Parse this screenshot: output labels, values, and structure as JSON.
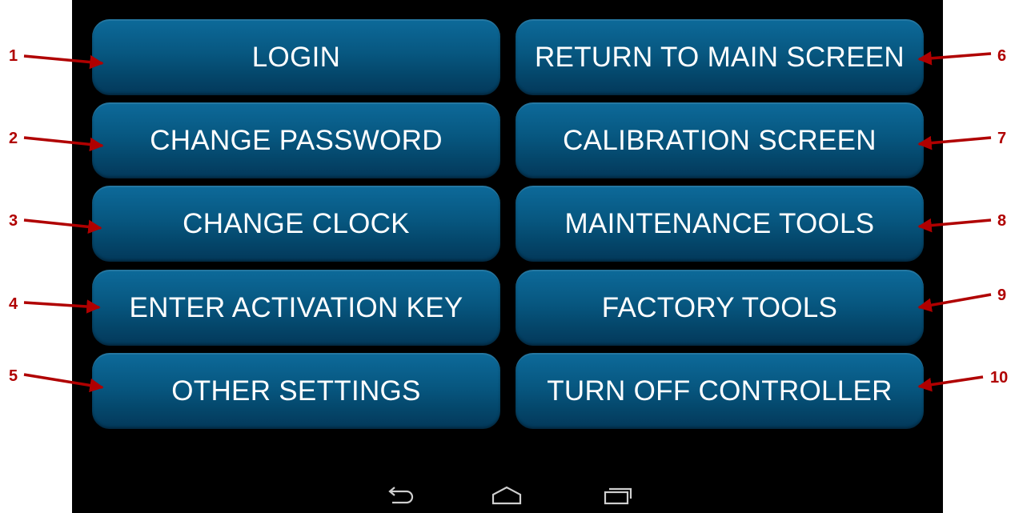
{
  "buttons_left": [
    {
      "label": "LOGIN",
      "callout": "1"
    },
    {
      "label": "CHANGE PASSWORD",
      "callout": "2"
    },
    {
      "label": "CHANGE CLOCK",
      "callout": "3"
    },
    {
      "label": "ENTER ACTIVATION KEY",
      "callout": "4"
    },
    {
      "label": "OTHER SETTINGS",
      "callout": "5"
    }
  ],
  "buttons_right": [
    {
      "label": "RETURN TO MAIN SCREEN",
      "callout": "6"
    },
    {
      "label": "CALIBRATION SCREEN",
      "callout": "7"
    },
    {
      "label": "MAINTENANCE TOOLS",
      "callout": "8"
    },
    {
      "label": "FACTORY TOOLS",
      "callout": "9"
    },
    {
      "label": "TURN OFF CONTROLLER",
      "callout": "10"
    }
  ],
  "navbar": {
    "icons": [
      "back-icon",
      "home-icon",
      "recent-apps-icon"
    ]
  },
  "colors": {
    "callout": "#b00000",
    "button_top": "#0d6a9a",
    "button_bottom": "#03385a",
    "screen_bg": "#000000"
  }
}
